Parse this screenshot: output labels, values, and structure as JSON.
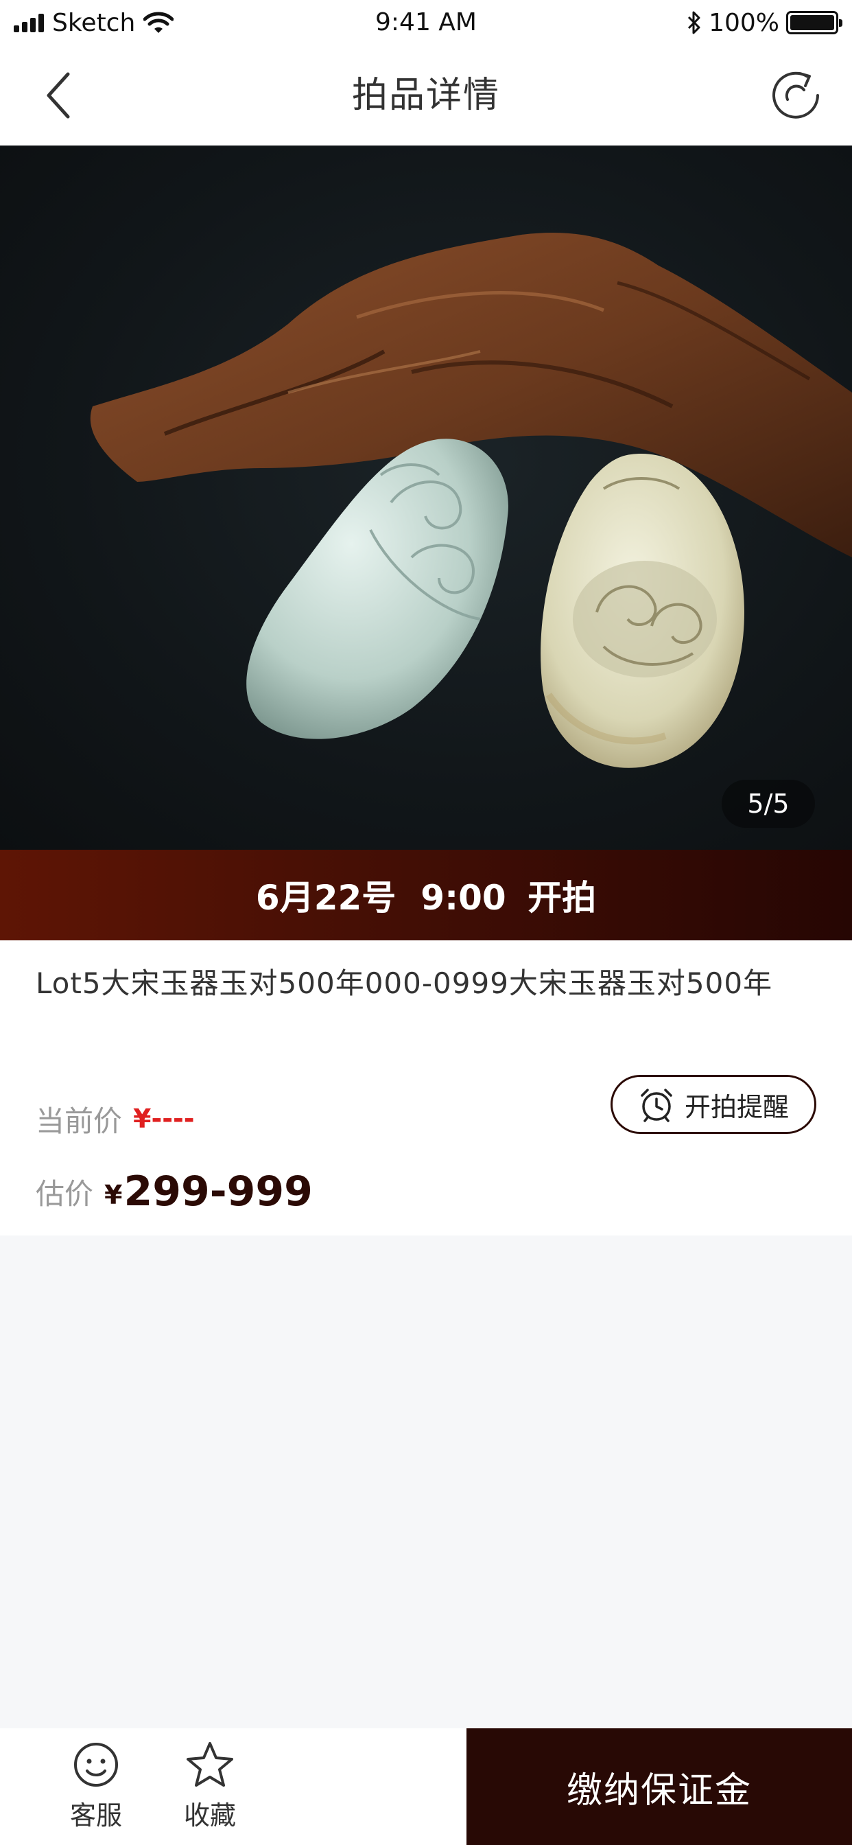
{
  "status_bar": {
    "carrier": "Sketch",
    "time": "9:41 AM",
    "battery": "100%"
  },
  "nav": {
    "title": "拍品详情"
  },
  "gallery": {
    "counter": "5/5"
  },
  "banner": {
    "date": "6月22号",
    "time": "9:00",
    "action": "开拍"
  },
  "lot": {
    "title": "Lot5大宋玉器玉对500年000-0999大宋玉器玉对500年",
    "current_price_label": "当前价",
    "current_price_value": "¥----",
    "estimate_label": "估价",
    "estimate_currency": "¥",
    "estimate_value": "299-999",
    "remind_label": "开拍提醒"
  },
  "bottom": {
    "service_label": "客服",
    "favorite_label": "收藏",
    "deposit_label": "缴纳保证金"
  },
  "colors": {
    "accent_dark": "#280905",
    "price_red": "#e02020",
    "banner_start": "#5e1505",
    "banner_end": "#260603"
  },
  "icons": [
    "back-chevron-icon",
    "refresh-icon",
    "alarm-clock-icon",
    "smiley-service-icon",
    "star-icon",
    "bluetooth-icon",
    "wifi-icon"
  ]
}
